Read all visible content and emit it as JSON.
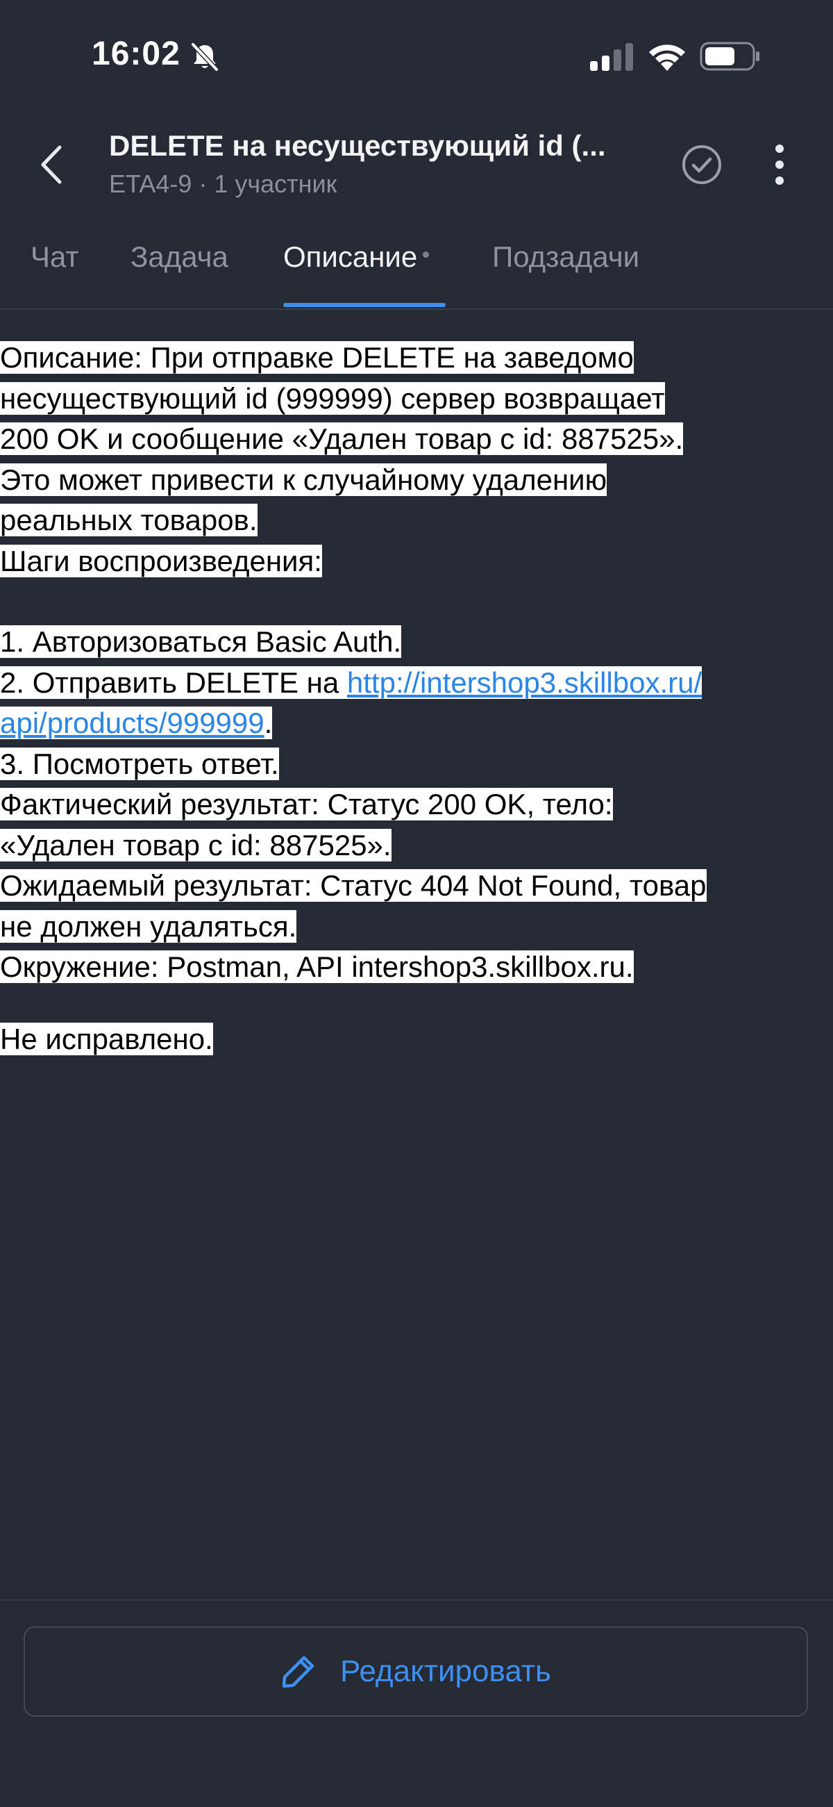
{
  "status_bar": {
    "time": "16:02"
  },
  "header": {
    "title": "DELETE на несуществующий id (...",
    "subtitle": "ETA4-9 · 1 участник"
  },
  "tabs": [
    {
      "label": "Чат"
    },
    {
      "label": "Задача"
    },
    {
      "label": "Описание",
      "active": true
    },
    {
      "label": "Подзадачи"
    }
  ],
  "description": {
    "lines": [
      "Описание: При отправке DELETE на заведомо",
      "несуществующий id (999999) сервер возвращает",
      "200 OK и сообщение «Удален товар с id: 887525».",
      "Это может привести к случайному удалению",
      "реальных товаров.",
      "Шаги воспроизведения:"
    ],
    "steps": {
      "step1": "1. Авторизоваться Basic Auth.",
      "step2_prefix": "2. Отправить DELETE на ",
      "step2_link_line1": "http://intershop3.skillbox.ru/",
      "step2_link_line2": "api/products/999999",
      "step2_suffix": ".",
      "step3": "3. Посмотреть ответ."
    },
    "results": [
      "Фактический результат: Статус 200 OK, тело:",
      "«Удален товар с id: 887525».",
      "Ожидаемый результат: Статус 404 Not Found, товар",
      "не должен удаляться.",
      "Окружение: Postman, API intershop3.skillbox.ru."
    ],
    "status_note": "Не исправлено."
  },
  "edit_button": {
    "label": "Редактировать"
  },
  "colors": {
    "background": "#262a35",
    "accent": "#3d8ff0",
    "link": "#2a85e6",
    "muted_text": "#8a8f9c"
  }
}
